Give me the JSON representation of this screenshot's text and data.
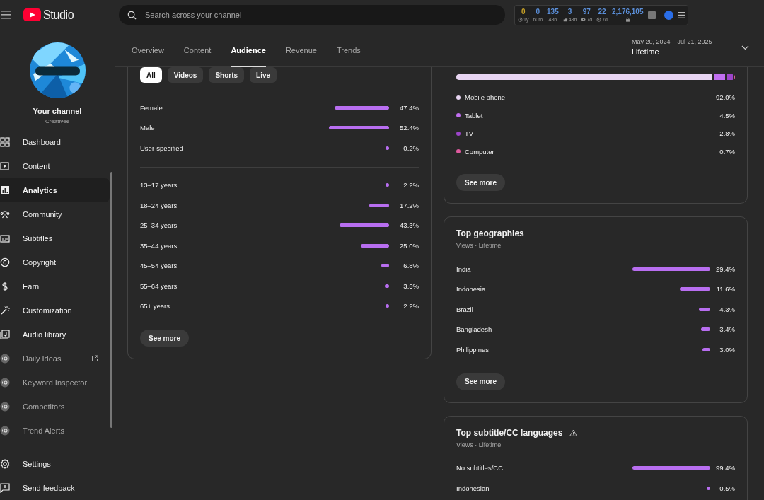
{
  "topbar": {
    "logo_text": "Studio",
    "search": {
      "placeholder": "Search across your channel"
    },
    "stats": [
      {
        "value": "0",
        "label": "1y",
        "kind": "clock",
        "color": "#c9a227"
      },
      {
        "value": "0",
        "label": "60m",
        "kind": "plain",
        "color": "#5b8fd9"
      },
      {
        "value": "135",
        "label": "48h",
        "kind": "plain",
        "color": "#5b8fd9"
      },
      {
        "value": "3",
        "label": "48h",
        "kind": "like",
        "color": "#5b8fd9"
      },
      {
        "value": "97",
        "label": "7d",
        "kind": "views",
        "color": "#5b8fd9"
      },
      {
        "value": "22",
        "label": "7d",
        "kind": "clock",
        "color": "#5b8fd9"
      },
      {
        "value": "2,176,105",
        "kind": "lock",
        "color": "#5b8fd9"
      }
    ]
  },
  "sidebar": {
    "channel": {
      "title": "Your channel",
      "name": "Creativee"
    },
    "items": [
      {
        "label": "Dashboard",
        "kind": "nav",
        "selected": false
      },
      {
        "label": "Content",
        "kind": "nav",
        "selected": false
      },
      {
        "label": "Analytics",
        "kind": "nav",
        "selected": true
      },
      {
        "label": "Community",
        "kind": "nav",
        "selected": false
      },
      {
        "label": "Subtitles",
        "kind": "nav",
        "selected": false
      },
      {
        "label": "Copyright",
        "kind": "nav",
        "selected": false
      },
      {
        "label": "Earn",
        "kind": "nav",
        "selected": false
      },
      {
        "label": "Customization",
        "kind": "nav",
        "selected": false
      },
      {
        "label": "Audio library",
        "kind": "nav",
        "selected": false
      },
      {
        "label": "Daily Ideas",
        "kind": "extension",
        "external": true,
        "selected": false
      },
      {
        "label": "Keyword Inspector",
        "kind": "extension",
        "selected": false
      },
      {
        "label": "Competitors",
        "kind": "extension",
        "selected": false
      },
      {
        "label": "Trend Alerts",
        "kind": "extension",
        "selected": false
      }
    ],
    "footer": [
      {
        "label": "Settings"
      },
      {
        "label": "Send feedback"
      }
    ]
  },
  "header": {
    "tabs": [
      {
        "label": "Overview",
        "selected": false
      },
      {
        "label": "Content",
        "selected": false
      },
      {
        "label": "Audience",
        "selected": true
      },
      {
        "label": "Revenue",
        "selected": false
      },
      {
        "label": "Trends",
        "selected": false
      }
    ],
    "date_range": {
      "range": "May 20, 2024 – Jul 21, 2025",
      "label": "Lifetime"
    }
  },
  "demographics": {
    "filters": [
      {
        "label": "All",
        "selected": true
      },
      {
        "label": "Videos",
        "selected": false
      },
      {
        "label": "Shorts",
        "selected": false
      },
      {
        "label": "Live",
        "selected": false
      }
    ],
    "gender": [
      {
        "label": "Female",
        "value": "47.4%"
      },
      {
        "label": "Male",
        "value": "52.4%"
      },
      {
        "label": "User-specified",
        "value": "0.2%"
      }
    ],
    "age": [
      {
        "label": "13–17 years",
        "value": "2.2%"
      },
      {
        "label": "18–24 years",
        "value": "17.2%"
      },
      {
        "label": "25–34 years",
        "value": "43.3%"
      },
      {
        "label": "35–44 years",
        "value": "25.0%"
      },
      {
        "label": "45–54 years",
        "value": "6.8%"
      },
      {
        "label": "55–64 years",
        "value": "3.5%"
      },
      {
        "label": "65+ years",
        "value": "2.2%"
      }
    ],
    "button": "See more"
  },
  "devices": {
    "rows": [
      {
        "label": "Mobile phone",
        "value": "92.0%",
        "color": "#e8d5f2"
      },
      {
        "label": "Tablet",
        "value": "4.5%",
        "color": "#c16ff0"
      },
      {
        "label": "TV",
        "value": "2.8%",
        "color": "#9c45c9"
      },
      {
        "label": "Computer",
        "value": "0.7%",
        "color": "#e05a9f"
      }
    ],
    "button": "See more"
  },
  "geographies": {
    "title": "Top geographies",
    "subtitle": "Views · Lifetime",
    "rows": [
      {
        "label": "India",
        "value": "29.4%"
      },
      {
        "label": "Indonesia",
        "value": "11.6%"
      },
      {
        "label": "Brazil",
        "value": "4.3%"
      },
      {
        "label": "Bangladesh",
        "value": "3.4%"
      },
      {
        "label": "Philippines",
        "value": "3.0%"
      }
    ],
    "button": "See more"
  },
  "subtitle_languages": {
    "title": "Top subtitle/CC languages",
    "warning": true,
    "subtitle": "Views · Lifetime",
    "rows": [
      {
        "label": "No subtitles/CC",
        "value": "99.4%"
      },
      {
        "label": "Indonesian",
        "value": "0.5%"
      }
    ]
  }
}
